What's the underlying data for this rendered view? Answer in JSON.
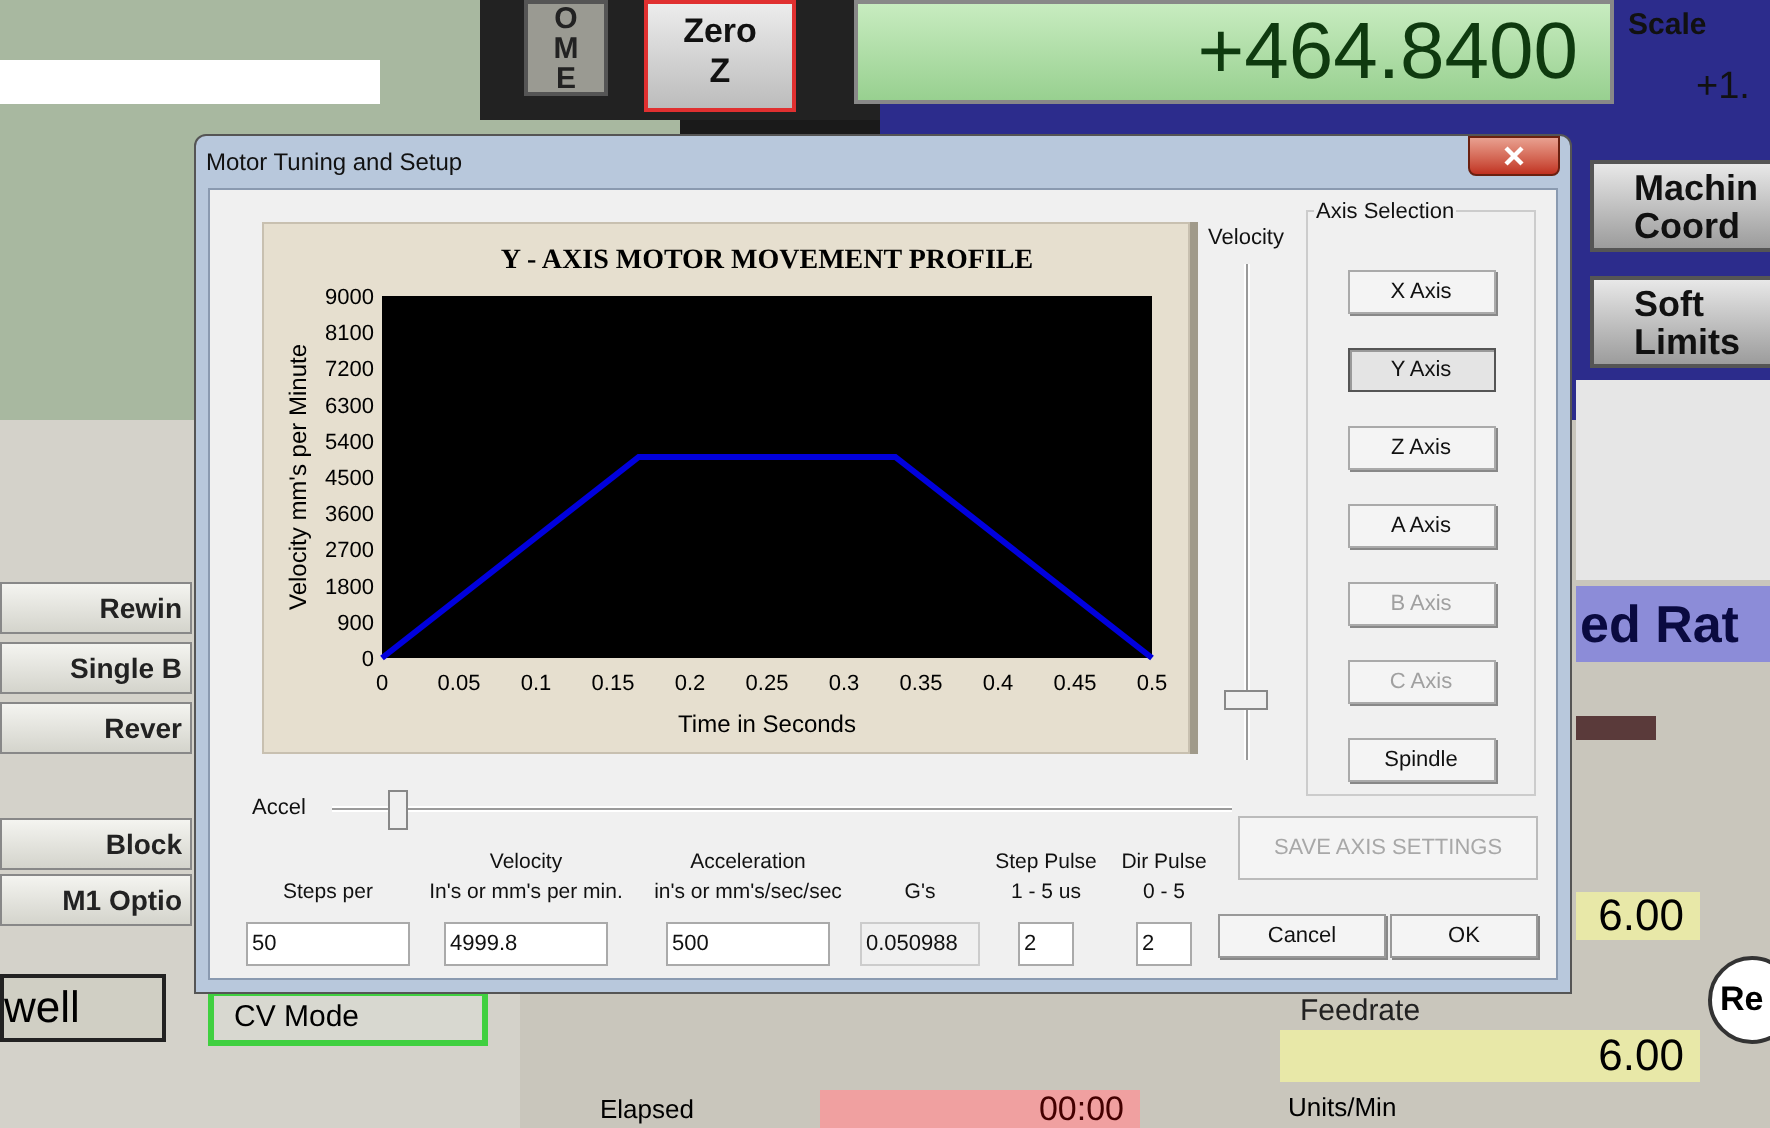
{
  "background": {
    "home_button": "OME",
    "zero_button": "Zero\nZ",
    "position_readout": "+464.8400",
    "scale_label": "Scale",
    "scale_value": "+1.",
    "right_buttons": [
      "Machin\nCoord",
      "Soft\nLimits"
    ],
    "feed_banner": "ed Rat",
    "feed_value": "6.00",
    "reset_button": "Re",
    "feedrate_label": "Feedrate",
    "feedrate_value": "6.00",
    "units_label": "Units/Min",
    "left_buttons": [
      "Rewin",
      "Single B",
      "Rever",
      "Block",
      "M1 Optio"
    ],
    "dwell_box": "well",
    "cv_mode": {
      "label": "CV Mode",
      "on": true
    },
    "elapsed_label": "Elapsed",
    "elapsed_value": "00:00"
  },
  "dialog": {
    "title": "Motor Tuning and Setup",
    "chart_data": {
      "type": "line",
      "title": "Y - AXIS MOTOR MOVEMENT PROFILE",
      "xlabel": "Time in Seconds",
      "ylabel": "Velocity mm's per Minute",
      "x": [
        0,
        0.1667,
        0.3333,
        0.5
      ],
      "series": [
        {
          "color": "#0000dd",
          "values": [
            0,
            5000,
            5000,
            0
          ]
        }
      ],
      "xlim": [
        0,
        0.5
      ],
      "ylim": [
        0,
        9000
      ],
      "xticks": [
        0,
        0.05,
        0.1,
        0.15,
        0.2,
        0.25,
        0.3,
        0.35,
        0.4,
        0.45,
        0.5
      ],
      "yticks": [
        0,
        900,
        1800,
        2700,
        3600,
        4500,
        5400,
        6300,
        7200,
        8100,
        9000
      ]
    },
    "velocity_slider": {
      "label": "Velocity",
      "level": 0.08
    },
    "axis_selection": {
      "title": "Axis Selection",
      "buttons": [
        {
          "label": "X Axis",
          "selected": false,
          "disabled": false
        },
        {
          "label": "Y Axis",
          "selected": true,
          "disabled": false
        },
        {
          "label": "Z Axis",
          "selected": false,
          "disabled": false
        },
        {
          "label": "A Axis",
          "selected": false,
          "disabled": false
        },
        {
          "label": "B Axis",
          "selected": false,
          "disabled": true
        },
        {
          "label": "C Axis",
          "selected": false,
          "disabled": true
        },
        {
          "label": "Spindle",
          "selected": false,
          "disabled": false
        }
      ]
    },
    "accel_slider": {
      "label": "Accel",
      "level": 0.05
    },
    "save_button": {
      "label": "SAVE AXIS SETTINGS",
      "disabled": true
    },
    "fields": [
      {
        "label": "Steps per",
        "value": "50",
        "readonly": false
      },
      {
        "label": "Velocity\nIn's or mm's per min.",
        "value": "4999.8",
        "readonly": false
      },
      {
        "label": "Acceleration\nin's or mm's/sec/sec",
        "value": "500",
        "readonly": false
      },
      {
        "label": "G's",
        "value": "0.050988",
        "readonly": true
      },
      {
        "label": "Step Pulse\n1 - 5 us",
        "value": "2",
        "readonly": false
      },
      {
        "label": "Dir Pulse\n0 - 5",
        "value": "2",
        "readonly": false
      }
    ],
    "buttons": [
      "Cancel",
      "OK"
    ]
  }
}
